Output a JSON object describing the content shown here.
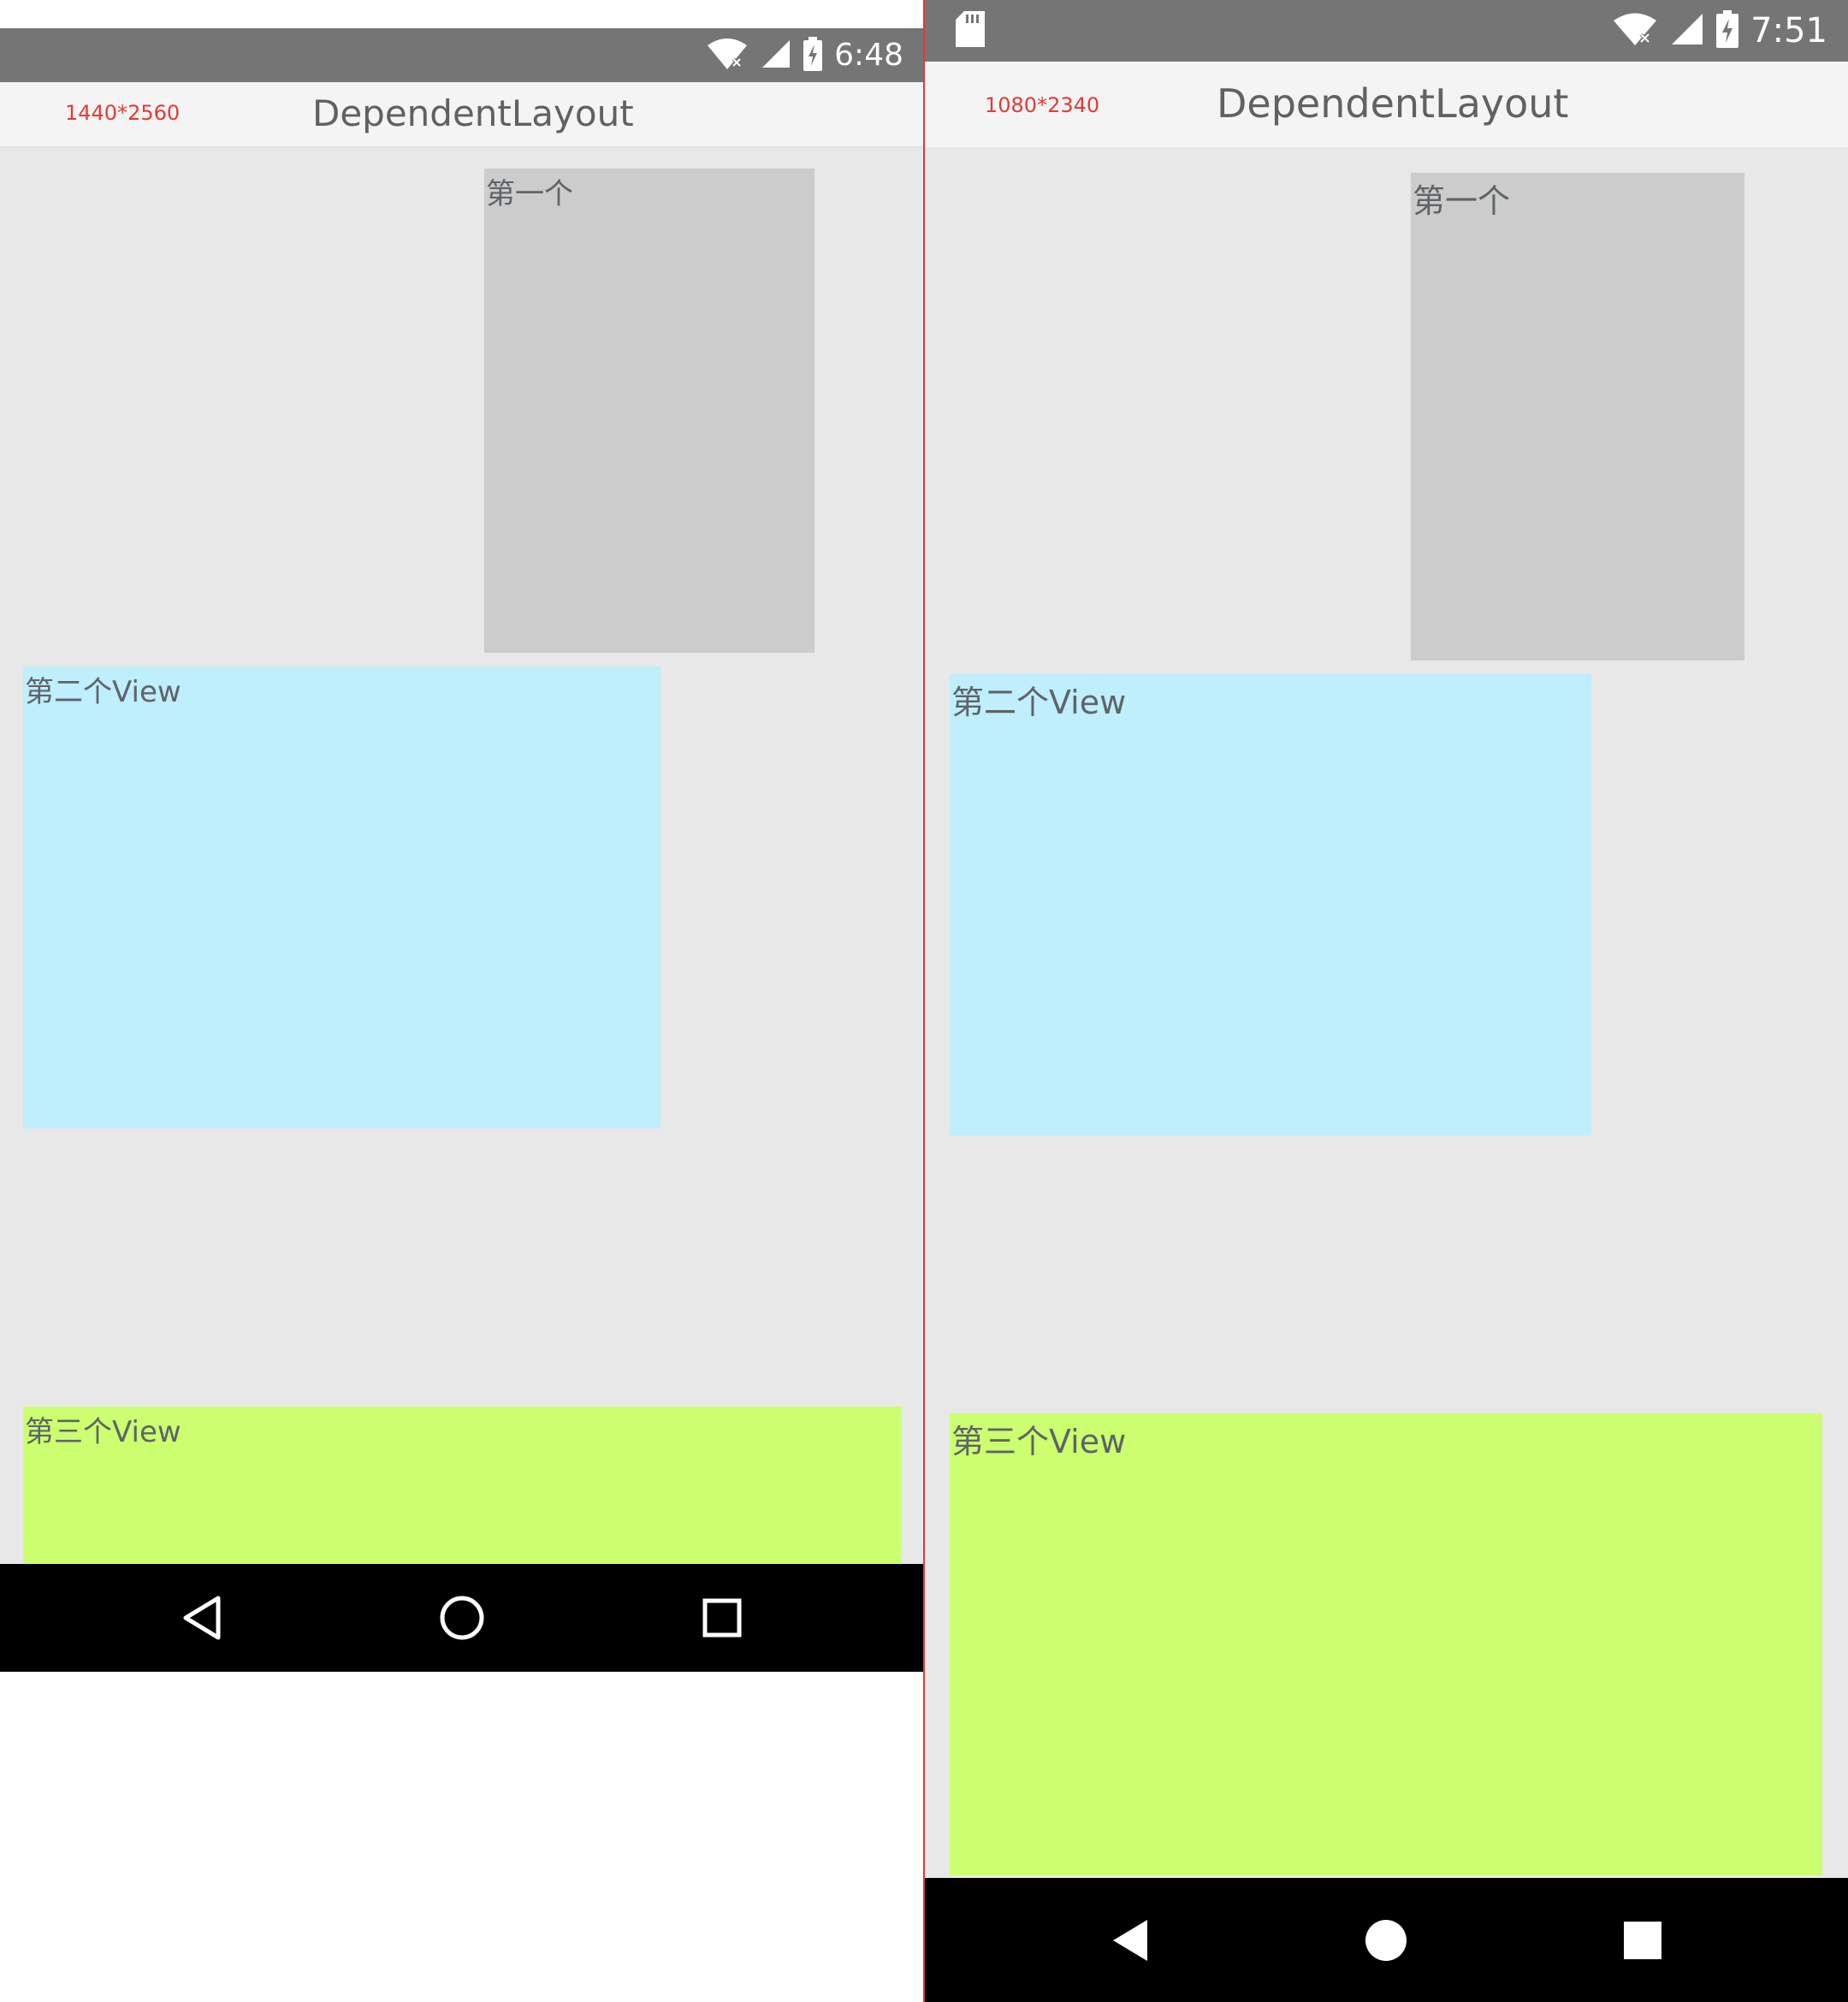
{
  "left_phone": {
    "status_bar": {
      "time": "6:48",
      "icons": [
        "wifi-icon",
        "signal-icon",
        "battery-charging-icon"
      ]
    },
    "app_bar": {
      "resolution_label": "1440*2560",
      "title": "DependentLayout"
    },
    "views": {
      "first": "第一个",
      "second": "第二个View",
      "third": "第三个View"
    },
    "nav_bar": {
      "buttons": [
        "back-icon",
        "home-icon",
        "recents-icon"
      ]
    }
  },
  "right_phone": {
    "status_bar": {
      "time": "7:51",
      "icons": [
        "sd-card-icon",
        "wifi-icon",
        "signal-icon",
        "battery-charging-icon"
      ]
    },
    "app_bar": {
      "resolution_label": "1080*2340",
      "title": "DependentLayout"
    },
    "views": {
      "first": "第一个",
      "second": "第二个View",
      "third": "第三个View"
    },
    "nav_bar": {
      "buttons": [
        "back-icon",
        "home-icon",
        "recents-icon"
      ]
    }
  },
  "colors": {
    "status_bar": "#757575",
    "app_bar": "#f4f4f4",
    "content_bg": "#e8e8e8",
    "first_view": "#cccccc",
    "second_view": "#bfeefc",
    "third_view": "#ccff70",
    "resolution_text": "#e53935",
    "divider": "#e53935"
  }
}
